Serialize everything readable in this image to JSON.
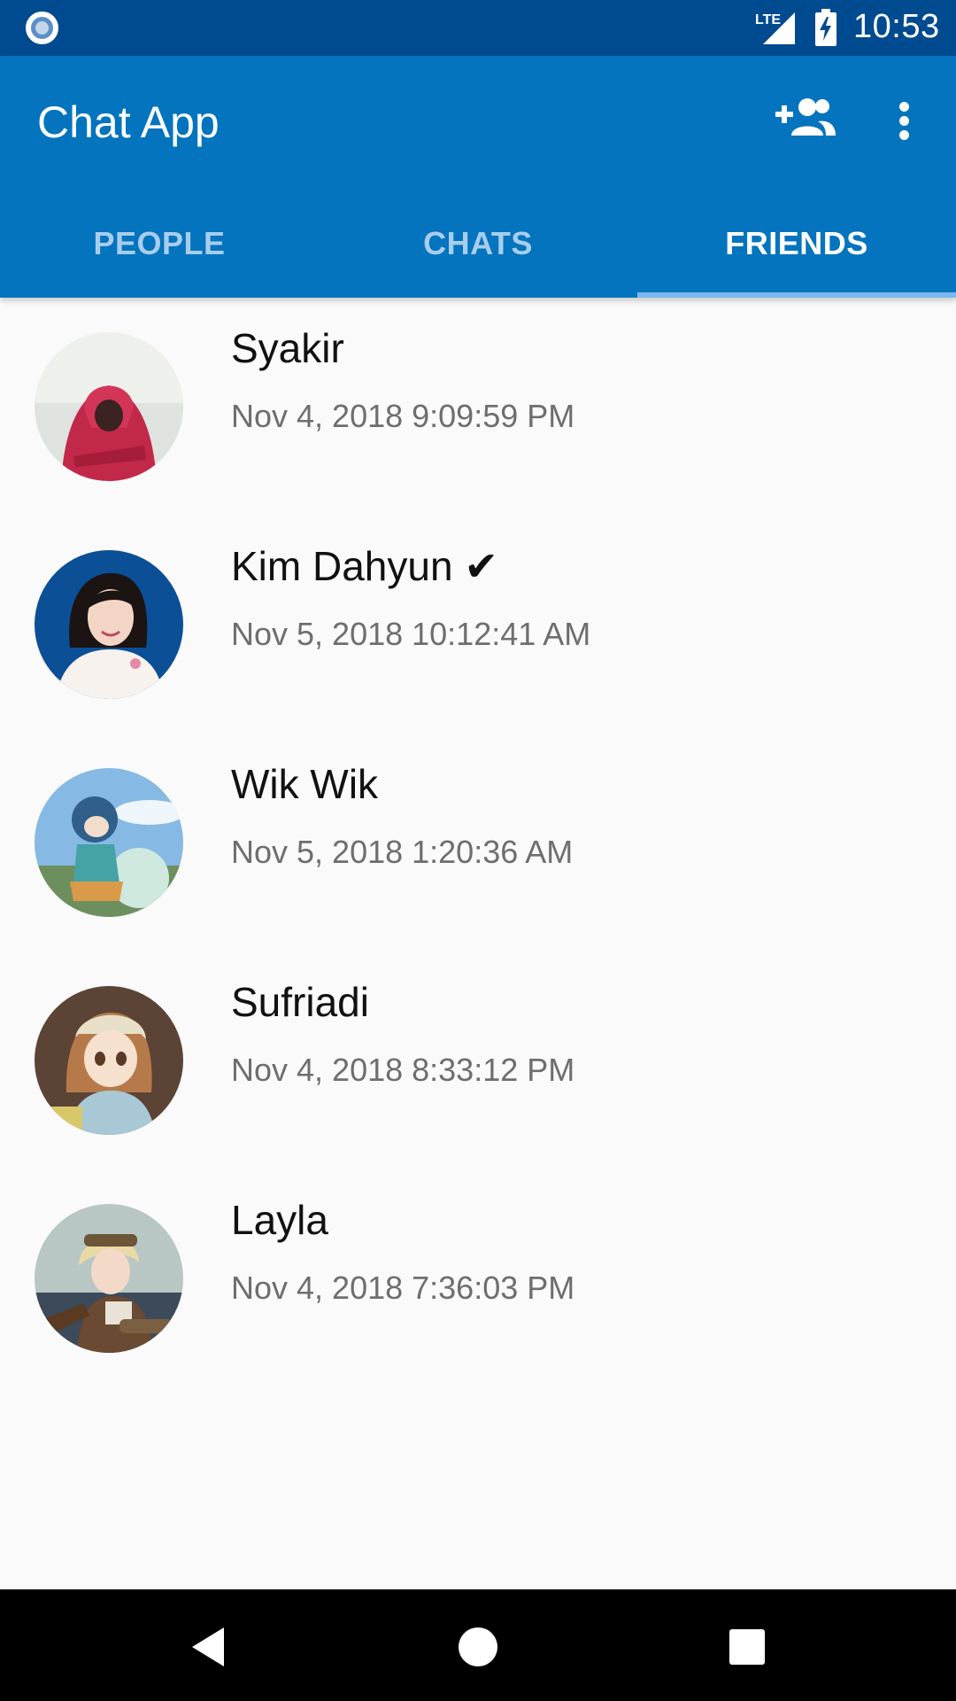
{
  "status_bar": {
    "clock": "10:53",
    "network": "LTE",
    "icons": [
      "record-icon",
      "lte-signal-icon",
      "battery-charging-icon"
    ]
  },
  "app_bar": {
    "title": "Chat App",
    "actions": [
      "add-friend-icon",
      "more-vert-icon"
    ]
  },
  "tabs": [
    {
      "label": "PEOPLE",
      "active": false
    },
    {
      "label": "CHATS",
      "active": false
    },
    {
      "label": "FRIENDS",
      "active": true
    }
  ],
  "friends": [
    {
      "name": "Syakir",
      "time": "Nov 4, 2018 9:09:59 PM"
    },
    {
      "name": "Kim Dahyun ✔",
      "time": "Nov 5, 2018 10:12:41 AM"
    },
    {
      "name": "Wik Wik",
      "time": "Nov 5, 2018 1:20:36 AM"
    },
    {
      "name": "Sufriadi",
      "time": "Nov 4, 2018 8:33:12 PM"
    },
    {
      "name": "Layla",
      "time": "Nov 4, 2018 7:36:03 PM"
    }
  ],
  "nav_bar": {
    "buttons": [
      "back-icon",
      "home-icon",
      "recents-icon"
    ]
  },
  "colors": {
    "status_bar": "#004a8f",
    "app_bar": "#0374bd",
    "tab_indicator": "#7ab8f0",
    "inactive_tab": "#a8cdec",
    "background": "#fafafa"
  }
}
